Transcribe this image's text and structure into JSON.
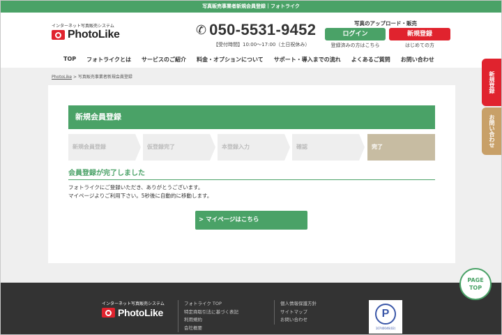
{
  "topbar": {
    "title": "写真販売事業者新規会員登録｜フォトライク"
  },
  "header": {
    "logo_sub": "インターネット写真販売システム",
    "logo_text": "PhotoLike",
    "phone": "050-5531-9452",
    "hours": "【受付時間】10:00〜17:00（土日祝休み）",
    "upload_title": "写真のアップロード・販売",
    "login_label": "ログイン",
    "login_caption": "登録済みの方はこちら",
    "register_label": "新規登録",
    "register_caption": "はじめての方"
  },
  "nav": {
    "items": [
      {
        "label": "TOP"
      },
      {
        "label": "フォトライクとは"
      },
      {
        "label": "サービスのご紹介"
      },
      {
        "label": "料金・オプションについて"
      },
      {
        "label": "サポート・導入までの流れ"
      },
      {
        "label": "よくあるご質問"
      },
      {
        "label": "お問い合わせ"
      }
    ]
  },
  "breadcrumb": {
    "home": "PhotoLike",
    "sep": " > ",
    "current": "写真販売事業者新規会員登録"
  },
  "main": {
    "heading": "新規会員登録",
    "steps": [
      {
        "label": "新規会員登録"
      },
      {
        "label": "仮登録完了"
      },
      {
        "label": "本登録入力"
      },
      {
        "label": "確認"
      },
      {
        "label": "完了"
      }
    ],
    "section_title": "会員登録が完了しました",
    "message_line1": "フォトライクにご登録いただき、ありがとうございます。",
    "message_line2": "マイページよりご利用下さい。5秒後に自動的に移動します。",
    "mypage_button": "> マイページはこちら"
  },
  "side_tabs": {
    "register": "新規登録",
    "contact": "お問い合わせ"
  },
  "page_top": {
    "line1": "PAGE",
    "line2": "TOP"
  },
  "footer": {
    "logo_sub": "インターネット写真販売システム",
    "logo_text": "PhotoLike",
    "col1": [
      "フォトライク TOP",
      "特定商取引法に基づく表記",
      "利用規約",
      "会社概要"
    ],
    "col2": [
      "個人情報保護方針",
      "サイトマップ",
      "お問い合わせ"
    ],
    "privacy_mark": {
      "symbol": "P",
      "number": "10740046(02)"
    }
  },
  "colors": {
    "green": "#4aa267",
    "red": "#e0232e",
    "tan": "#c7bca2",
    "footer": "#333333"
  }
}
